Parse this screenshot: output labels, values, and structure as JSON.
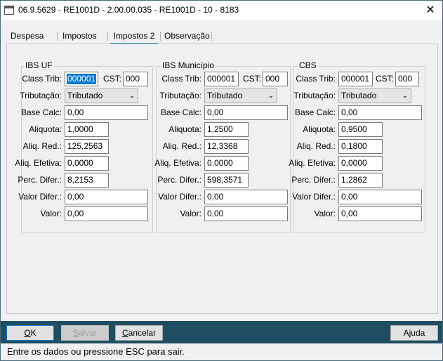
{
  "window": {
    "title": "06.9.5629 - RE1001D - 2.00.00.035 - RE1001D - 10 - 8183",
    "close_glyph": "✕"
  },
  "tabs": [
    {
      "label": "Despesa"
    },
    {
      "label": "Impostos"
    },
    {
      "label": "Impostos 2",
      "active": true
    },
    {
      "label": "Observação"
    }
  ],
  "labels": {
    "class_trib": "Class Trib:",
    "cst": "CST:",
    "tributacao": "Tributação:",
    "base_calc": "Base Calc:",
    "aliquota": "Aliquota:",
    "aliq_red": "Aliq. Red.:",
    "aliq_efetiva": "Aliq. Efetiva:",
    "perc_difer": "Perc. Difer.:",
    "valor_difer": "Valor Difer.:",
    "valor": "Valor:"
  },
  "groups": [
    {
      "title": "IBS UF",
      "class_trib": "000001",
      "cst": "000",
      "tributacao": "Tributado",
      "base_calc": "0,00",
      "aliquota": "1,0000",
      "aliq_red": "125,2563",
      "aliq_efetiva": "0,0000",
      "perc_difer": "8,2153",
      "valor_difer": "0,00",
      "valor": "0,00"
    },
    {
      "title": "IBS Município",
      "class_trib": "000001",
      "cst": "000",
      "tributacao": "Tributado",
      "base_calc": "0,00",
      "aliquota": "1,2500",
      "aliq_red": "12,3368",
      "aliq_efetiva": "0,0000",
      "perc_difer": "598,3571",
      "valor_difer": "0,00",
      "valor": "0,00"
    },
    {
      "title": "CBS",
      "class_trib": "000001",
      "cst": "000",
      "tributacao": "Tributado",
      "base_calc": "0,00",
      "aliquota": "0,9500",
      "aliq_red": "0,1800",
      "aliq_efetiva": "0,0000",
      "perc_difer": "1,2862",
      "valor_difer": "0,00",
      "valor": "0,00"
    }
  ],
  "buttons": {
    "ok": {
      "label": "OK",
      "accel": "O",
      "rest": "K"
    },
    "salvar": {
      "label": "Salvar",
      "accel": "S",
      "rest": "alvar",
      "disabled": true
    },
    "cancelar": {
      "label": "Cancelar",
      "accel": "C",
      "rest": "ancelar"
    },
    "ajuda": {
      "label": "Ajuda"
    }
  },
  "status": {
    "text": "Entre os dados ou pressione ESC para sair."
  },
  "colors": {
    "bottom_bar": "#1f4e63",
    "selection": "#0078d7",
    "active_tab": "#1f82c9"
  }
}
